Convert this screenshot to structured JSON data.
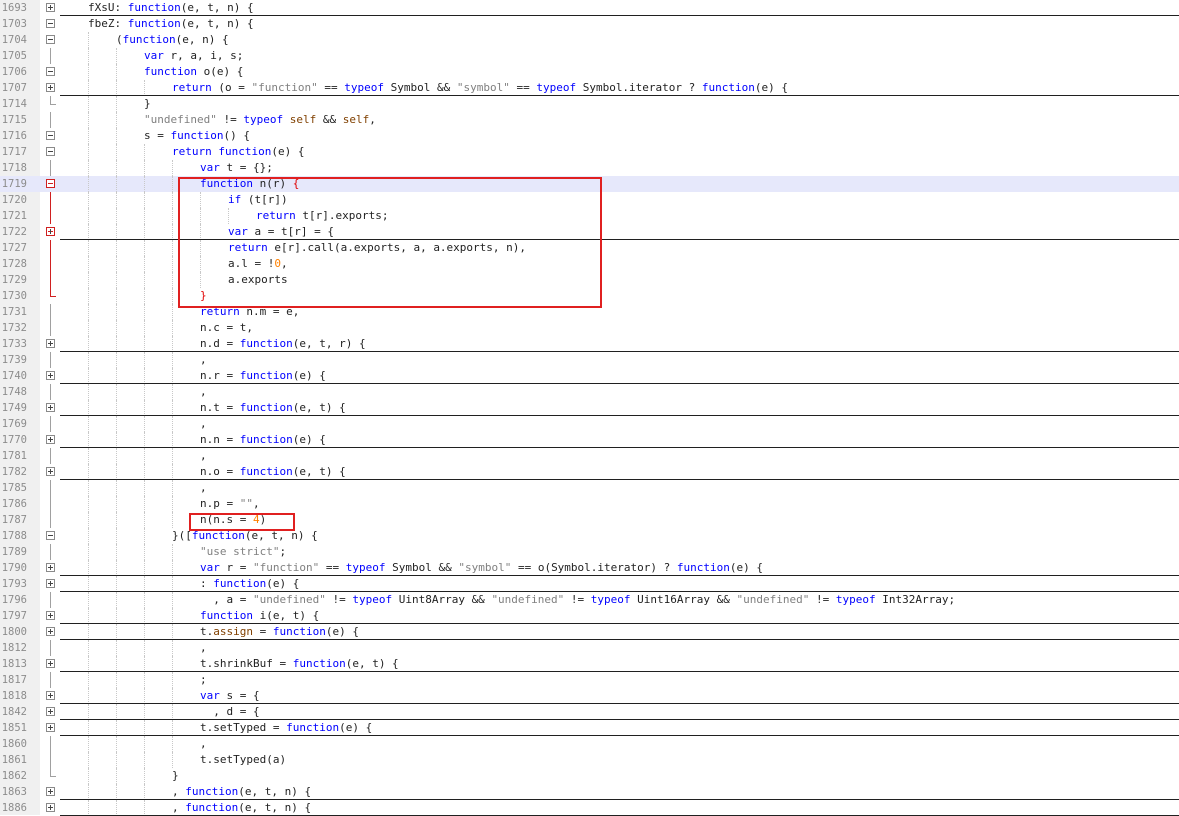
{
  "editor": {
    "lines": [
      {
        "ln": "1693",
        "fold": "plus",
        "indent": 1,
        "under": true,
        "tokens": [
          [
            "fXsU: ",
            ""
          ],
          [
            "function",
            "k"
          ],
          [
            "(e, t, n) {",
            ""
          ]
        ]
      },
      {
        "ln": "1703",
        "fold": "minus",
        "indent": 1,
        "tokens": [
          [
            "fbeZ: ",
            ""
          ],
          [
            "function",
            "k"
          ],
          [
            "(e, t, n) {",
            ""
          ]
        ]
      },
      {
        "ln": "1704",
        "fold": "minus",
        "indent": 2,
        "tokens": [
          [
            "(",
            ""
          ],
          [
            "function",
            "k"
          ],
          [
            "(e, n) {",
            ""
          ]
        ]
      },
      {
        "ln": "1705",
        "fold": "vline",
        "indent": 3,
        "tokens": [
          [
            "var",
            "k"
          ],
          [
            " r, a, i, s;",
            ""
          ]
        ]
      },
      {
        "ln": "1706",
        "fold": "minus",
        "indent": 3,
        "tokens": [
          [
            "function",
            "k"
          ],
          [
            " o(e) {",
            ""
          ]
        ]
      },
      {
        "ln": "1707",
        "fold": "plus",
        "indent": 4,
        "under": true,
        "tokens": [
          [
            "return",
            "k"
          ],
          [
            " (o = ",
            ""
          ],
          [
            "\"function\"",
            "s"
          ],
          [
            " == ",
            ""
          ],
          [
            "typeof",
            "k"
          ],
          [
            " Symbol && ",
            ""
          ],
          [
            "\"symbol\"",
            "s"
          ],
          [
            " == ",
            ""
          ],
          [
            "typeof",
            "k"
          ],
          [
            " Symbol.iterator ? ",
            ""
          ],
          [
            "function",
            "k"
          ],
          [
            "(e) {",
            ""
          ]
        ]
      },
      {
        "ln": "1714",
        "fold": "tick",
        "indent": 3,
        "tokens": [
          [
            "}",
            ""
          ]
        ]
      },
      {
        "ln": "1715",
        "fold": "vline",
        "indent": 3,
        "tokens": [
          [
            "\"undefined\"",
            "s"
          ],
          [
            " != ",
            ""
          ],
          [
            "typeof",
            "k"
          ],
          [
            " ",
            ""
          ],
          [
            "self",
            "v"
          ],
          [
            " && ",
            ""
          ],
          [
            "self",
            "v"
          ],
          [
            ",",
            ""
          ]
        ]
      },
      {
        "ln": "1716",
        "fold": "minus",
        "indent": 3,
        "tokens": [
          [
            "s = ",
            ""
          ],
          [
            "function",
            "k"
          ],
          [
            "() {",
            ""
          ]
        ]
      },
      {
        "ln": "1717",
        "fold": "minus",
        "indent": 4,
        "tokens": [
          [
            "return",
            "k"
          ],
          [
            " ",
            ""
          ],
          [
            "function",
            "k"
          ],
          [
            "(e) {",
            ""
          ]
        ]
      },
      {
        "ln": "1718",
        "fold": "vline",
        "indent": 5,
        "tokens": [
          [
            "var",
            "k"
          ],
          [
            " t = {};",
            ""
          ]
        ]
      },
      {
        "ln": "1719",
        "fold": "minus-red",
        "indent": 5,
        "hl": true,
        "tokens": [
          [
            "function",
            "k"
          ],
          [
            " n(r) ",
            ""
          ],
          [
            "{",
            "r"
          ]
        ]
      },
      {
        "ln": "1720",
        "fold": "vline-red",
        "indent": 6,
        "tokens": [
          [
            "if",
            "k"
          ],
          [
            " (t[r])",
            ""
          ]
        ]
      },
      {
        "ln": "1721",
        "fold": "vline-red",
        "indent": 7,
        "tokens": [
          [
            "return",
            "k"
          ],
          [
            " t[r].exports;",
            ""
          ]
        ]
      },
      {
        "ln": "1722",
        "fold": "plus-red",
        "indent": 6,
        "under": true,
        "tokens": [
          [
            "var",
            "k"
          ],
          [
            " a = t[r] = {",
            ""
          ]
        ]
      },
      {
        "ln": "1727",
        "fold": "vline-red",
        "indent": 6,
        "tokens": [
          [
            "return",
            "k"
          ],
          [
            " e[r].call(a.exports, a, a.exports, n),",
            ""
          ]
        ]
      },
      {
        "ln": "1728",
        "fold": "vline-red",
        "indent": 6,
        "tokens": [
          [
            "a.l = !",
            ""
          ],
          [
            "0",
            "n"
          ],
          [
            ",",
            ""
          ]
        ]
      },
      {
        "ln": "1729",
        "fold": "vline-red",
        "indent": 6,
        "tokens": [
          [
            "a.exports",
            ""
          ]
        ]
      },
      {
        "ln": "1730",
        "fold": "tick-red",
        "indent": 5,
        "tokens": [
          [
            "}",
            "r"
          ]
        ]
      },
      {
        "ln": "1731",
        "fold": "vline",
        "indent": 5,
        "tokens": [
          [
            "return",
            "k"
          ],
          [
            " n.m = e,",
            ""
          ]
        ]
      },
      {
        "ln": "1732",
        "fold": "vline",
        "indent": 5,
        "tokens": [
          [
            "n.c = t,",
            ""
          ]
        ]
      },
      {
        "ln": "1733",
        "fold": "plus",
        "indent": 5,
        "under": true,
        "tokens": [
          [
            "n.d = ",
            ""
          ],
          [
            "function",
            "k"
          ],
          [
            "(e, t, r) {",
            ""
          ]
        ]
      },
      {
        "ln": "1739",
        "fold": "vline",
        "indent": 5,
        "tokens": [
          [
            ",",
            ""
          ]
        ]
      },
      {
        "ln": "1740",
        "fold": "plus",
        "indent": 5,
        "under": true,
        "tokens": [
          [
            "n.r = ",
            ""
          ],
          [
            "function",
            "k"
          ],
          [
            "(e) {",
            ""
          ]
        ]
      },
      {
        "ln": "1748",
        "fold": "vline",
        "indent": 5,
        "tokens": [
          [
            ",",
            ""
          ]
        ]
      },
      {
        "ln": "1749",
        "fold": "plus",
        "indent": 5,
        "under": true,
        "tokens": [
          [
            "n.t = ",
            ""
          ],
          [
            "function",
            "k"
          ],
          [
            "(e, t) {",
            ""
          ]
        ]
      },
      {
        "ln": "1769",
        "fold": "vline",
        "indent": 5,
        "tokens": [
          [
            ",",
            ""
          ]
        ]
      },
      {
        "ln": "1770",
        "fold": "plus",
        "indent": 5,
        "under": true,
        "tokens": [
          [
            "n.n = ",
            ""
          ],
          [
            "function",
            "k"
          ],
          [
            "(e) {",
            ""
          ]
        ]
      },
      {
        "ln": "1781",
        "fold": "vline",
        "indent": 5,
        "tokens": [
          [
            ",",
            ""
          ]
        ]
      },
      {
        "ln": "1782",
        "fold": "plus",
        "indent": 5,
        "under": true,
        "tokens": [
          [
            "n.o = ",
            ""
          ],
          [
            "function",
            "k"
          ],
          [
            "(e, t) {",
            ""
          ]
        ]
      },
      {
        "ln": "1785",
        "fold": "vline",
        "indent": 5,
        "tokens": [
          [
            ",",
            ""
          ]
        ]
      },
      {
        "ln": "1786",
        "fold": "vline",
        "indent": 5,
        "tokens": [
          [
            "n.p = ",
            ""
          ],
          [
            "\"\"",
            "s"
          ],
          [
            ",",
            ""
          ]
        ]
      },
      {
        "ln": "1787",
        "fold": "vline",
        "indent": 5,
        "tokens": [
          [
            "n(n.s = ",
            ""
          ],
          [
            "4",
            "n"
          ],
          [
            ")",
            ""
          ]
        ]
      },
      {
        "ln": "1788",
        "fold": "minus",
        "indent": 4,
        "tokens": [
          [
            "}([",
            ""
          ],
          [
            "function",
            "k"
          ],
          [
            "(e, t, n) {",
            ""
          ]
        ]
      },
      {
        "ln": "1789",
        "fold": "vline",
        "indent": 5,
        "tokens": [
          [
            "\"use strict\"",
            "s"
          ],
          [
            ";",
            ""
          ]
        ]
      },
      {
        "ln": "1790",
        "fold": "plus",
        "indent": 5,
        "under": true,
        "tokens": [
          [
            "var",
            "k"
          ],
          [
            " r = ",
            ""
          ],
          [
            "\"function\"",
            "s"
          ],
          [
            " == ",
            ""
          ],
          [
            "typeof",
            "k"
          ],
          [
            " Symbol && ",
            ""
          ],
          [
            "\"symbol\"",
            "s"
          ],
          [
            " == o(Symbol.iterator) ? ",
            ""
          ],
          [
            "function",
            "k"
          ],
          [
            "(e) {",
            ""
          ]
        ]
      },
      {
        "ln": "1793",
        "fold": "plus",
        "indent": 5,
        "under": true,
        "tokens": [
          [
            ": ",
            ""
          ],
          [
            "function",
            "k"
          ],
          [
            "(e) {",
            ""
          ]
        ]
      },
      {
        "ln": "1796",
        "fold": "vline",
        "indent": 5,
        "tokens": [
          [
            "  , a = ",
            ""
          ],
          [
            "\"undefined\"",
            "s"
          ],
          [
            " != ",
            ""
          ],
          [
            "typeof",
            "k"
          ],
          [
            " Uint8Array && ",
            ""
          ],
          [
            "\"undefined\"",
            "s"
          ],
          [
            " != ",
            ""
          ],
          [
            "typeof",
            "k"
          ],
          [
            " Uint16Array && ",
            ""
          ],
          [
            "\"undefined\"",
            "s"
          ],
          [
            " != ",
            ""
          ],
          [
            "typeof",
            "k"
          ],
          [
            " Int32Array;",
            ""
          ]
        ]
      },
      {
        "ln": "1797",
        "fold": "plus",
        "indent": 5,
        "under": true,
        "tokens": [
          [
            "function",
            "k"
          ],
          [
            " i(e, t) {",
            ""
          ]
        ]
      },
      {
        "ln": "1800",
        "fold": "plus",
        "indent": 5,
        "under": true,
        "tokens": [
          [
            "t.",
            ""
          ],
          [
            "assign",
            "v"
          ],
          [
            " = ",
            ""
          ],
          [
            "function",
            "k"
          ],
          [
            "(e) {",
            ""
          ]
        ]
      },
      {
        "ln": "1812",
        "fold": "vline",
        "indent": 5,
        "tokens": [
          [
            ",",
            ""
          ]
        ]
      },
      {
        "ln": "1813",
        "fold": "plus",
        "indent": 5,
        "under": true,
        "tokens": [
          [
            "t.shrinkBuf = ",
            ""
          ],
          [
            "function",
            "k"
          ],
          [
            "(e, t) {",
            ""
          ]
        ]
      },
      {
        "ln": "1817",
        "fold": "vline",
        "indent": 5,
        "tokens": [
          [
            ";",
            ""
          ]
        ]
      },
      {
        "ln": "1818",
        "fold": "plus",
        "indent": 5,
        "under": true,
        "tokens": [
          [
            "var",
            "k"
          ],
          [
            " s = {",
            ""
          ]
        ]
      },
      {
        "ln": "1842",
        "fold": "plus",
        "indent": 5,
        "under": true,
        "tokens": [
          [
            "  , d = {",
            ""
          ]
        ]
      },
      {
        "ln": "1851",
        "fold": "plus",
        "indent": 5,
        "under": true,
        "tokens": [
          [
            "t.setTyped = ",
            ""
          ],
          [
            "function",
            "k"
          ],
          [
            "(e) {",
            ""
          ]
        ]
      },
      {
        "ln": "1860",
        "fold": "vline",
        "indent": 5,
        "tokens": [
          [
            ",",
            ""
          ]
        ]
      },
      {
        "ln": "1861",
        "fold": "vline",
        "indent": 5,
        "tokens": [
          [
            "t.setTyped(a)",
            ""
          ]
        ]
      },
      {
        "ln": "1862",
        "fold": "tick",
        "indent": 4,
        "tokens": [
          [
            "}",
            ""
          ]
        ]
      },
      {
        "ln": "1863",
        "fold": "plus",
        "indent": 4,
        "under": true,
        "tokens": [
          [
            ", ",
            ""
          ],
          [
            "function",
            "k"
          ],
          [
            "(e, t, n) {",
            ""
          ]
        ]
      },
      {
        "ln": "1886",
        "fold": "plus",
        "indent": 4,
        "under": true,
        "tokens": [
          [
            ", ",
            ""
          ],
          [
            "function",
            "k"
          ],
          [
            "(e, t, n) {",
            ""
          ]
        ]
      }
    ]
  }
}
